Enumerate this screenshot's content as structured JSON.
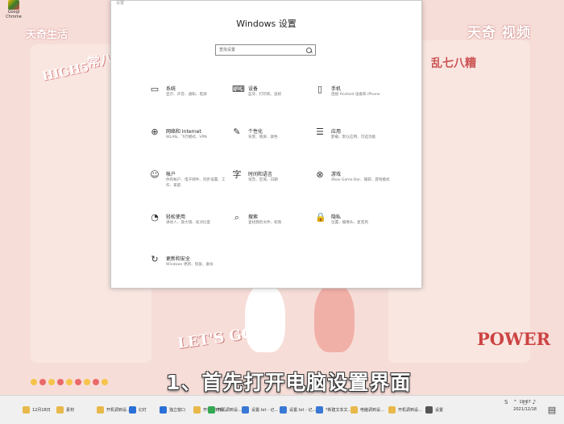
{
  "desktop": {
    "icon_label": "Googl\nChrome",
    "watermark_left": "天奇生活",
    "watermark_right": "天奇 视频",
    "deco_high5": "HIGH5",
    "deco_chang": "常八",
    "deco_luan": "乱七八糟",
    "deco_letsgo": "LET'S GO!!!",
    "deco_power": "POWER",
    "dot_colors": [
      "#f5c44a",
      "#e96a6a",
      "#f5c44a",
      "#e96a6a",
      "#f5c44a",
      "#e96a6a",
      "#f5c44a",
      "#e96a6a",
      "#f5c44a"
    ]
  },
  "caption": "1、首先打开电脑设置界面",
  "settings_window": {
    "titlebar": "设置",
    "heading": "Windows 设置",
    "search_placeholder": "查找设置",
    "tiles": [
      {
        "icon": "laptop-icon",
        "glyph": "▭",
        "title": "系统",
        "desc": "显示、声音、通知、电源"
      },
      {
        "icon": "devices-icon",
        "glyph": "⌨",
        "title": "设备",
        "desc": "蓝牙、打印机、鼠标"
      },
      {
        "icon": "phone-icon",
        "glyph": "▯",
        "title": "手机",
        "desc": "连接 Android 设备和 iPhone"
      },
      {
        "icon": "globe-icon",
        "glyph": "⊕",
        "title": "网络和 Internet",
        "desc": "WLAN、飞行模式、VPN"
      },
      {
        "icon": "paintbrush-icon",
        "glyph": "✎",
        "title": "个性化",
        "desc": "背景、锁屏、颜色"
      },
      {
        "icon": "apps-list-icon",
        "glyph": "☰",
        "title": "应用",
        "desc": "卸载、默认应用、可选功能"
      },
      {
        "icon": "person-icon",
        "glyph": "☺",
        "title": "帐户",
        "desc": "你的帐户、电子邮件、同步设置、工作、家庭"
      },
      {
        "icon": "language-icon",
        "glyph": "字",
        "title": "时间和语言",
        "desc": "语音、区域、日期"
      },
      {
        "icon": "xbox-icon",
        "glyph": "⊗",
        "title": "游戏",
        "desc": "Xbox Game Bar、捕获、游戏模式"
      },
      {
        "icon": "accessibility-icon",
        "glyph": "◔",
        "title": "轻松使用",
        "desc": "讲述人、放大镜、高对比度"
      },
      {
        "icon": "search-icon",
        "glyph": "⌕",
        "title": "搜索",
        "desc": "查找我的文件、权限"
      },
      {
        "icon": "lock-icon",
        "glyph": "🔒",
        "title": "隐私",
        "desc": "位置、摄像头、麦克风"
      },
      {
        "icon": "update-icon",
        "glyph": "↻",
        "title": "更新和安全",
        "desc": "Windows 更新、恢复、备份"
      }
    ]
  },
  "taskbar": {
    "items": [
      {
        "label": "12月18日",
        "color": "#e8b84a"
      },
      {
        "label": "素材",
        "color": "#e8b84a"
      },
      {
        "label": "开机调到设...",
        "color": "#e8b84a"
      },
      {
        "label": "幻灯",
        "color": "#2a6fd6"
      },
      {
        "label": "独立窗口",
        "color": "#2a6fd6"
      },
      {
        "label": "开机调到设...",
        "color": "#e8b84a"
      },
      {
        "label": "开机调到设...",
        "color": "#34a853"
      },
      {
        "label": "设置.txt - 记...",
        "color": "#3a78d6"
      },
      {
        "label": "设置.txt - 记...",
        "color": "#3a78d6"
      },
      {
        "label": "*新建文本文...",
        "color": "#3a78d6"
      },
      {
        "label": "电脑调到设...",
        "color": "#e8b84a"
      },
      {
        "label": "开机调到设...",
        "color": "#e8b84a"
      },
      {
        "label": "设置",
        "color": "#555555"
      }
    ],
    "tray_time": "10:07",
    "tray_date": "2021/12/18"
  }
}
